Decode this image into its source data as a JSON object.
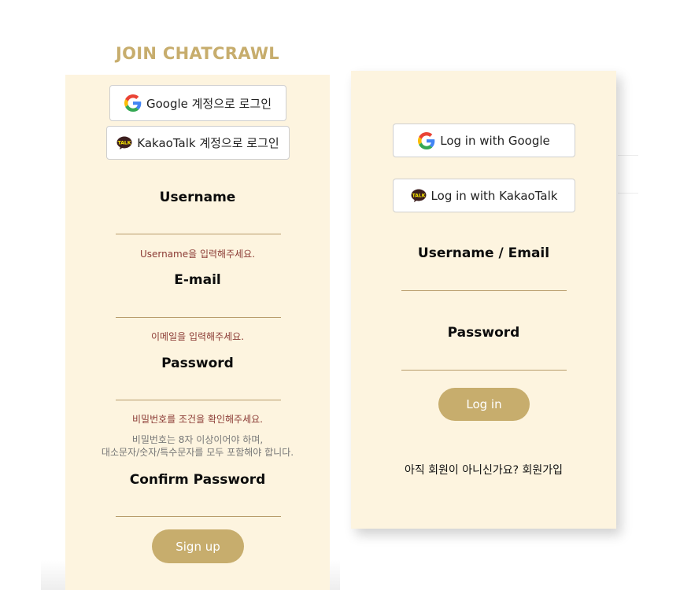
{
  "signup": {
    "title": "JOIN CHATCRAWL",
    "google_button": "Google 계정으로 로그인",
    "kakao_button": "KakaoTalk 계정으로 로그인",
    "username_label": "Username",
    "username_hint": "Username을 입력해주세요.",
    "email_label": "E-mail",
    "email_hint": "이메일을 입력해주세요.",
    "password_label": "Password",
    "password_hint": "비밀번호를 조건을 확인해주세요.",
    "password_rule_line1": "비밀번호는 8자 이상이어야 하며,",
    "password_rule_line2": "대소문자/숫자/특수문자를 모두 포함해야 합니다.",
    "confirm_label": "Confirm Password",
    "submit": "Sign up"
  },
  "login": {
    "google_button": "Log in with Google",
    "kakao_button": "Log in with KakaoTalk",
    "username_label": "Username / Email",
    "password_label": "Password",
    "submit": "Log in",
    "no_account_text": "아직 회원이 아니신가요?",
    "signup_link": "회원가입"
  },
  "colors": {
    "accent": "#c7ad6d",
    "panel_bg": "#fdf4df",
    "hint": "#8b3a34",
    "underline": "#b79b6a"
  },
  "icons": {
    "google": "google-g-logo",
    "kakao": "kakaotalk-talk-bubble"
  }
}
